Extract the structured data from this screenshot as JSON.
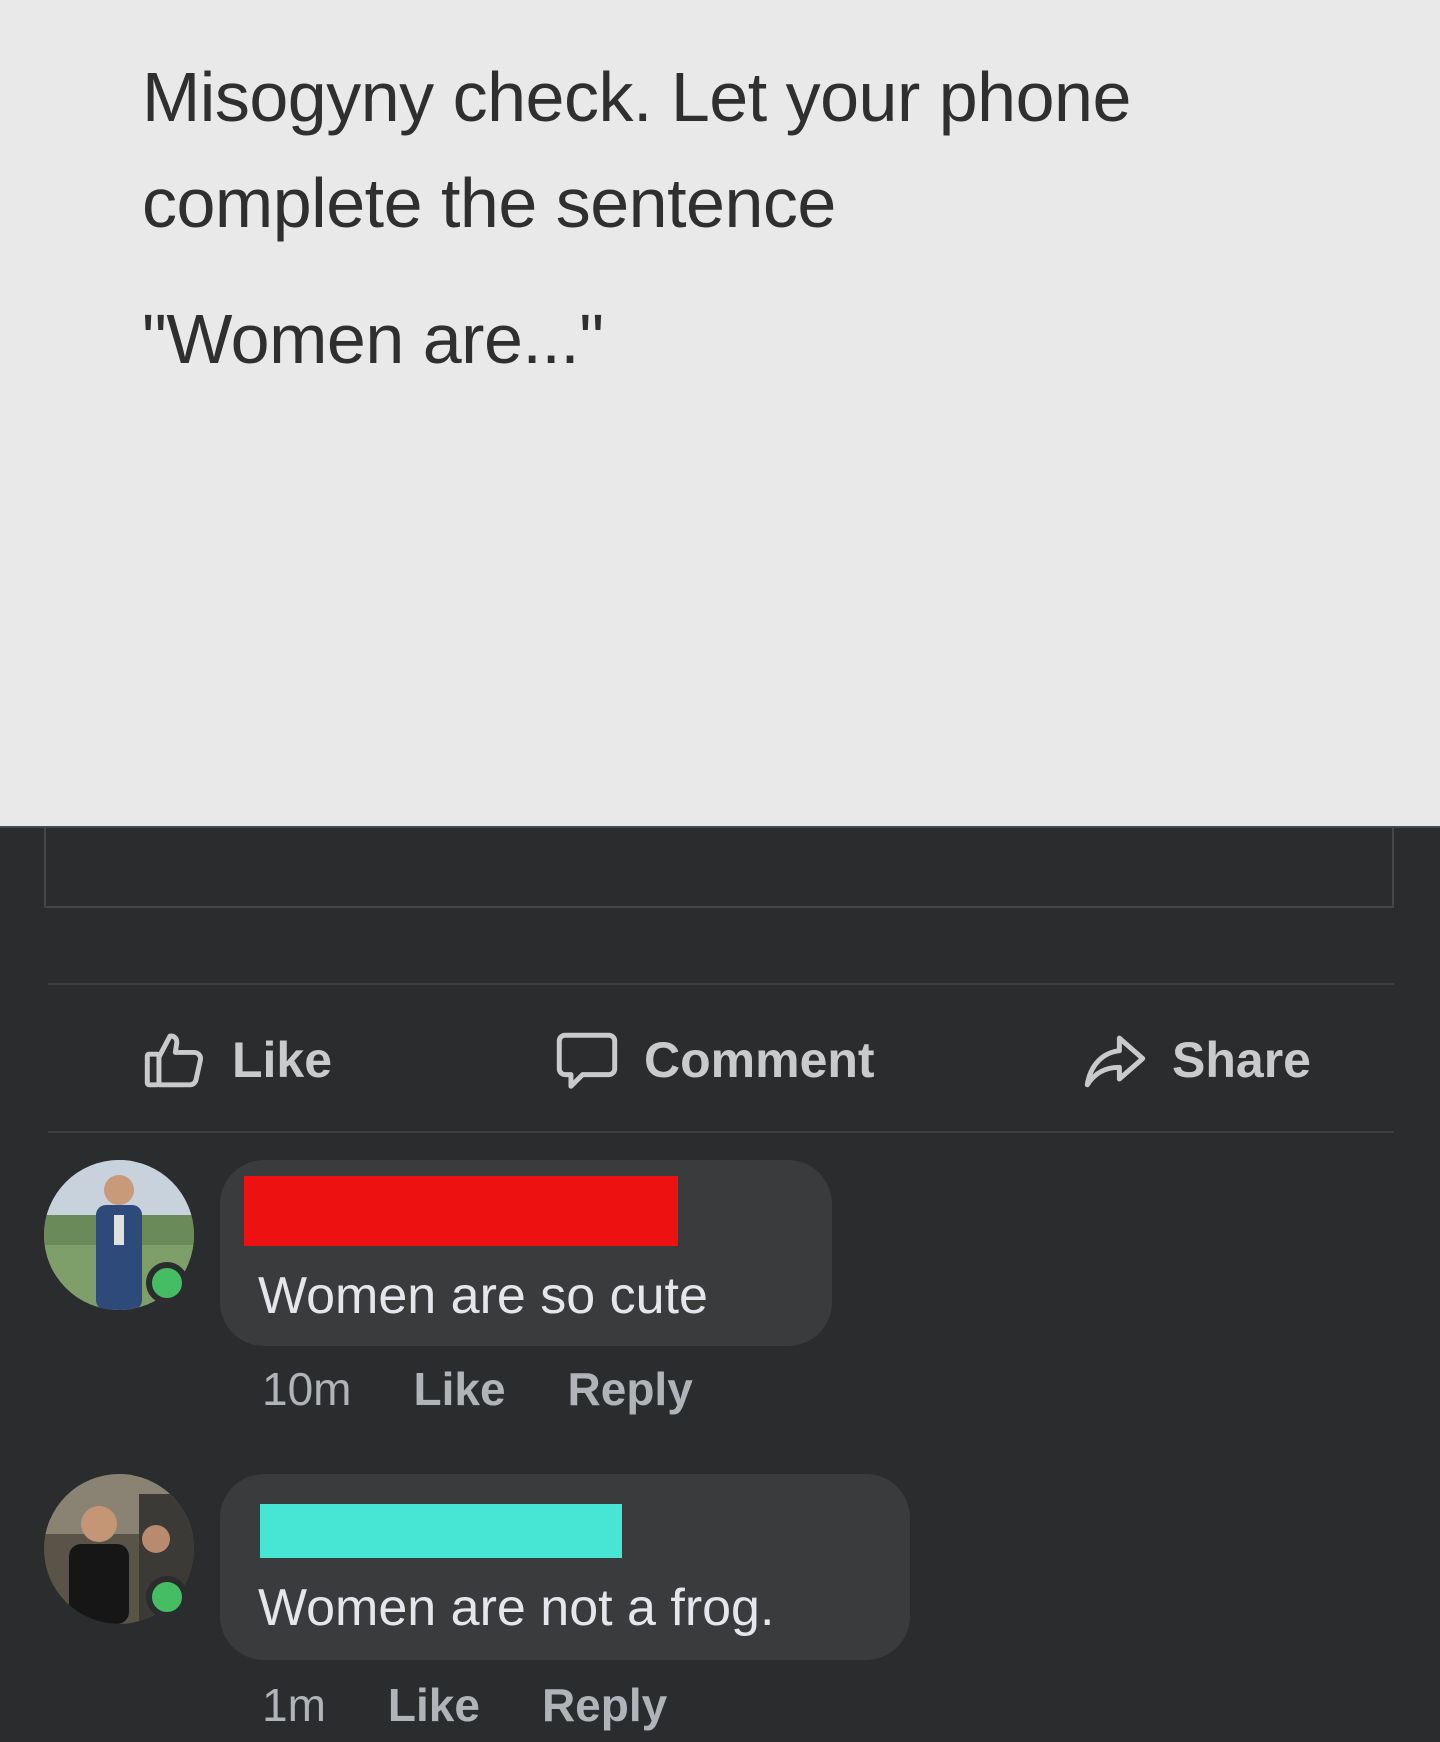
{
  "post": {
    "line1": "Misogyny check. Let your phone",
    "line2": "complete the sentence",
    "quote": "\"Women are...\""
  },
  "actions": {
    "like_label": "Like",
    "comment_label": "Comment",
    "share_label": "Share"
  },
  "comments": [
    {
      "name_redaction_color": "#ee1111",
      "text": "Women are so cute",
      "time": "10m",
      "like_label": "Like",
      "reply_label": "Reply",
      "online": true
    },
    {
      "name_redaction_color": "#47e6d4",
      "text": "Women are not a frog.",
      "time": "1m",
      "like_label": "Like",
      "reply_label": "Reply",
      "online": true
    }
  ],
  "colors": {
    "background": "#2b2c2e",
    "card": "#e9e9e9",
    "bubble": "#3a3b3d",
    "online": "#45bd62"
  }
}
